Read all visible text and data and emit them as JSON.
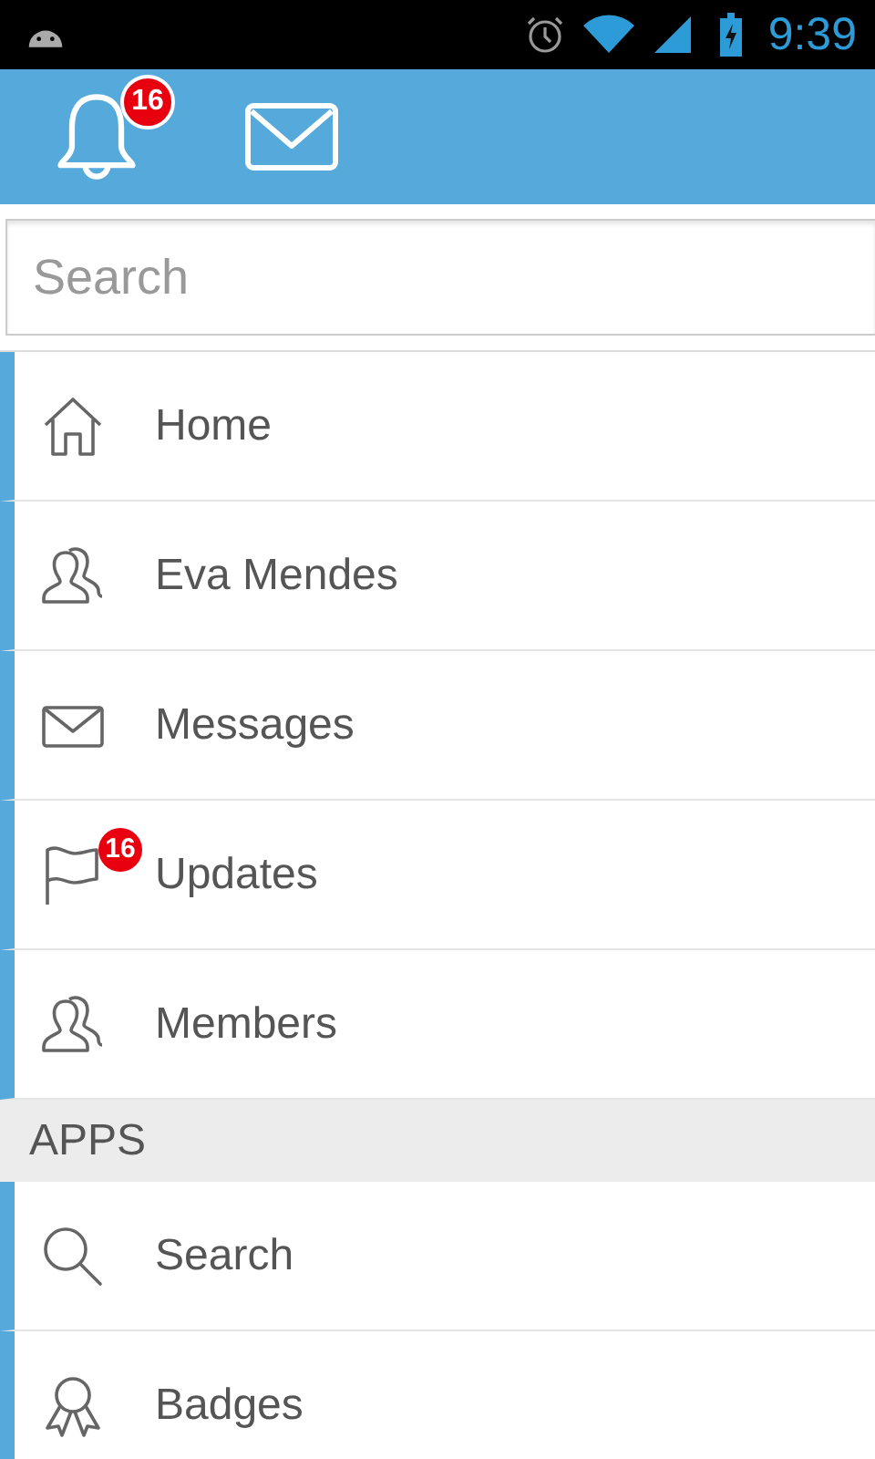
{
  "status_bar": {
    "time": "9:39"
  },
  "header": {
    "notifications_badge": "16"
  },
  "search": {
    "placeholder": "Search"
  },
  "menu": [
    {
      "kind": "home",
      "label": "Home"
    },
    {
      "kind": "people",
      "label": "Eva Mendes"
    },
    {
      "kind": "mail",
      "label": "Messages"
    },
    {
      "kind": "flag",
      "label": "Updates",
      "badge": "16"
    },
    {
      "kind": "people",
      "label": "Members"
    }
  ],
  "apps_section": {
    "title": "APPS",
    "items": [
      {
        "kind": "search",
        "label": "Search"
      },
      {
        "kind": "award",
        "label": "Badges"
      }
    ]
  }
}
